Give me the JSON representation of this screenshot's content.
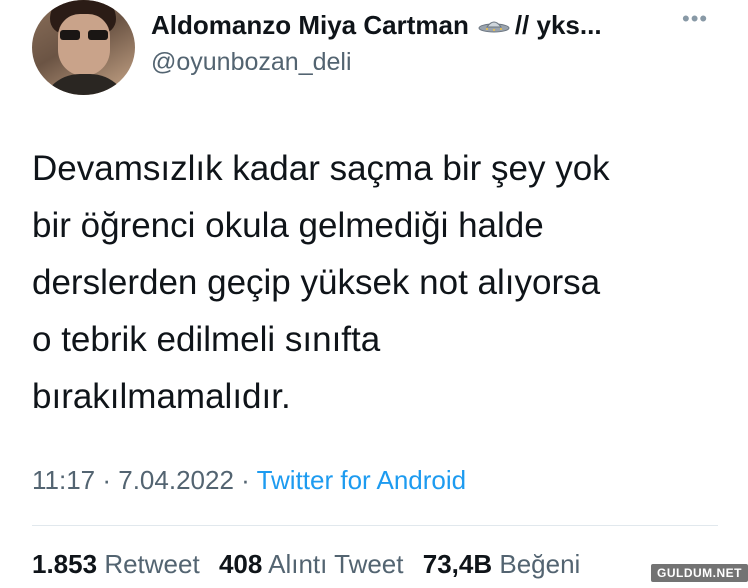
{
  "author": {
    "display_name": "Aldomanzo Miya Cartman",
    "name_suffix": "// yks...",
    "handle": "@oyunbozan_deli",
    "name_icon": "ufo-icon",
    "menu_icon": "more-horizontal-icon"
  },
  "tweet": {
    "lines": [
      "Devamsızlık kadar saçma bir şey yok",
      "bir öğrenci okula gelmediği halde",
      "derslerden geçip yüksek not alıyorsa",
      "o tebrik edilmeli sınıfta",
      "bırakılmamalıdır."
    ]
  },
  "meta": {
    "time": "11:17",
    "separator": " · ",
    "date": "7.04.2022",
    "source": "Twitter for Android"
  },
  "stats": {
    "retweets_count": "1.853",
    "retweets_label": "Retweet",
    "quotes_count": "408",
    "quotes_label": "Alıntı Tweet",
    "likes_count": "73,4B",
    "likes_label": "Beğeni"
  },
  "watermark": "GULDUM.NET",
  "colors": {
    "text": "#0f1419",
    "secondary": "#536471",
    "link": "#1d9bf0"
  }
}
